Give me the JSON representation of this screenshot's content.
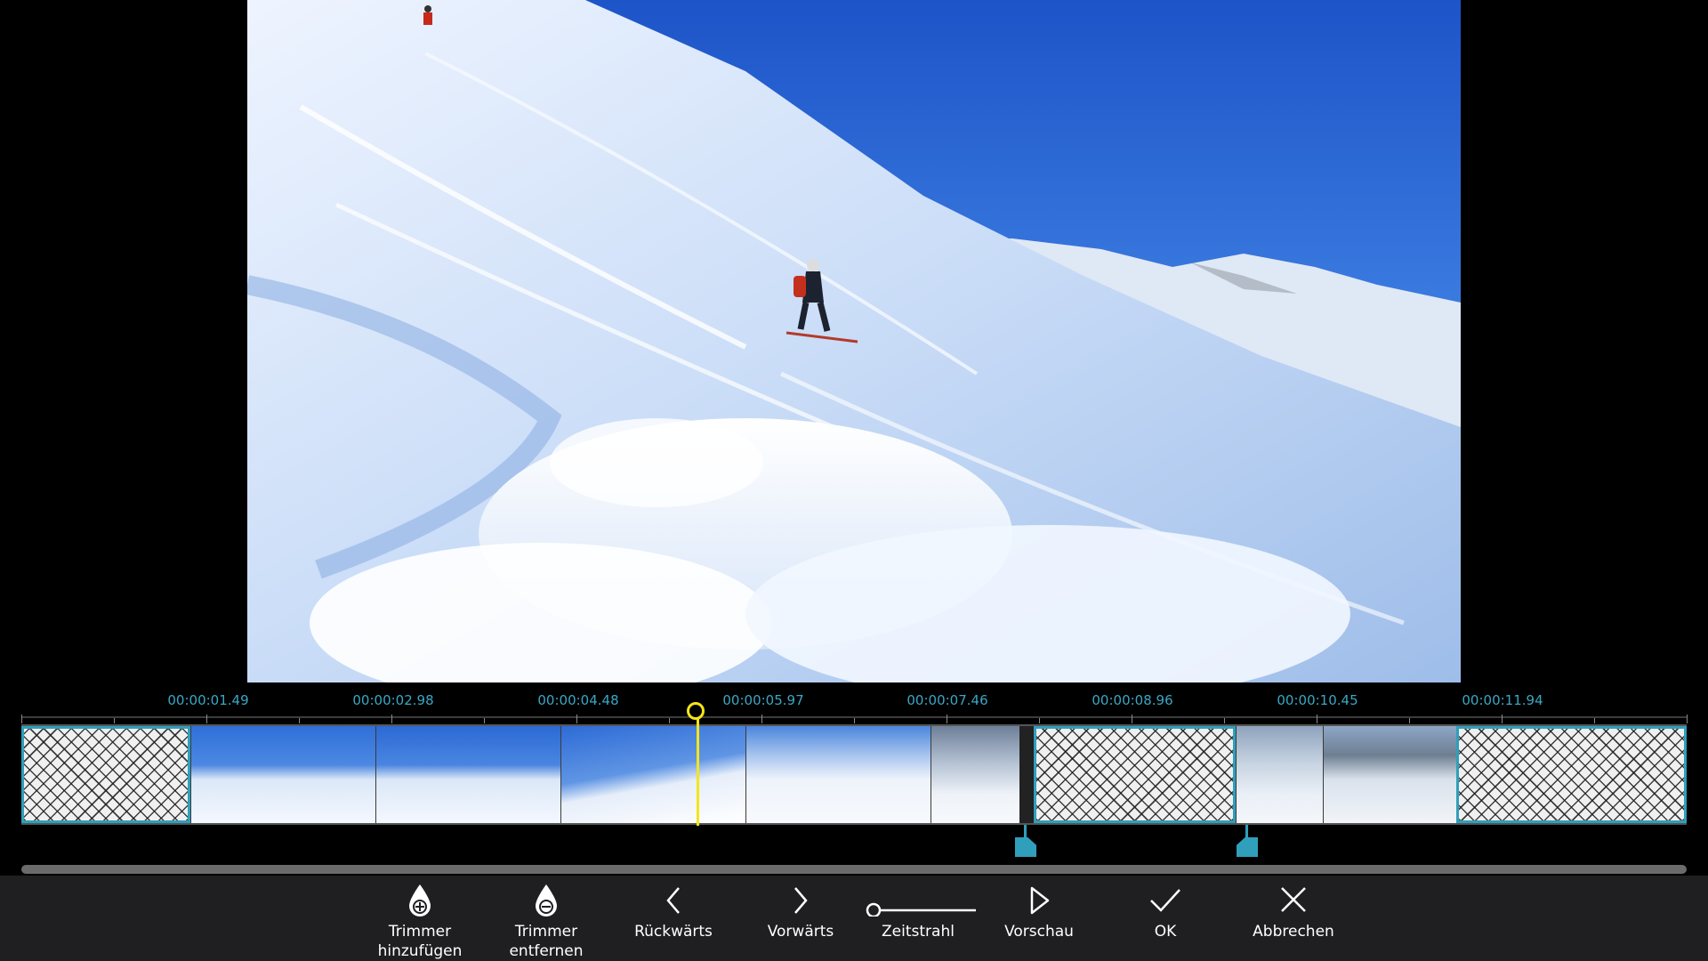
{
  "timeline": {
    "time_labels": [
      "00:00:01.49",
      "00:00:02.98",
      "00:00:04.48",
      "00:00:05.97",
      "00:00:07.46",
      "00:00:08.96",
      "00:00:10.45",
      "00:00:11.94"
    ]
  },
  "toolbar": {
    "trimmer_add": "Trimmer hinzufügen",
    "trimmer_remove": "Trimmer entfernen",
    "back": "Rückwärts",
    "forward": "Vorwärts",
    "timeline_zoom": "Zeitstrahl",
    "preview": "Vorschau",
    "ok": "OK",
    "cancel": "Abbrechen"
  },
  "colors": {
    "accent": "#2f9fbc",
    "playhead": "#f4e51b",
    "toolbar_bg": "#1f1f22"
  },
  "icons": {
    "trimmer_add": "droplet-plus-icon",
    "trimmer_remove": "droplet-minus-icon",
    "back": "chevron-left-icon",
    "forward": "chevron-right-icon",
    "timeline_zoom": "slider-icon",
    "preview": "play-icon",
    "ok": "checkmark-icon",
    "cancel": "close-icon"
  }
}
